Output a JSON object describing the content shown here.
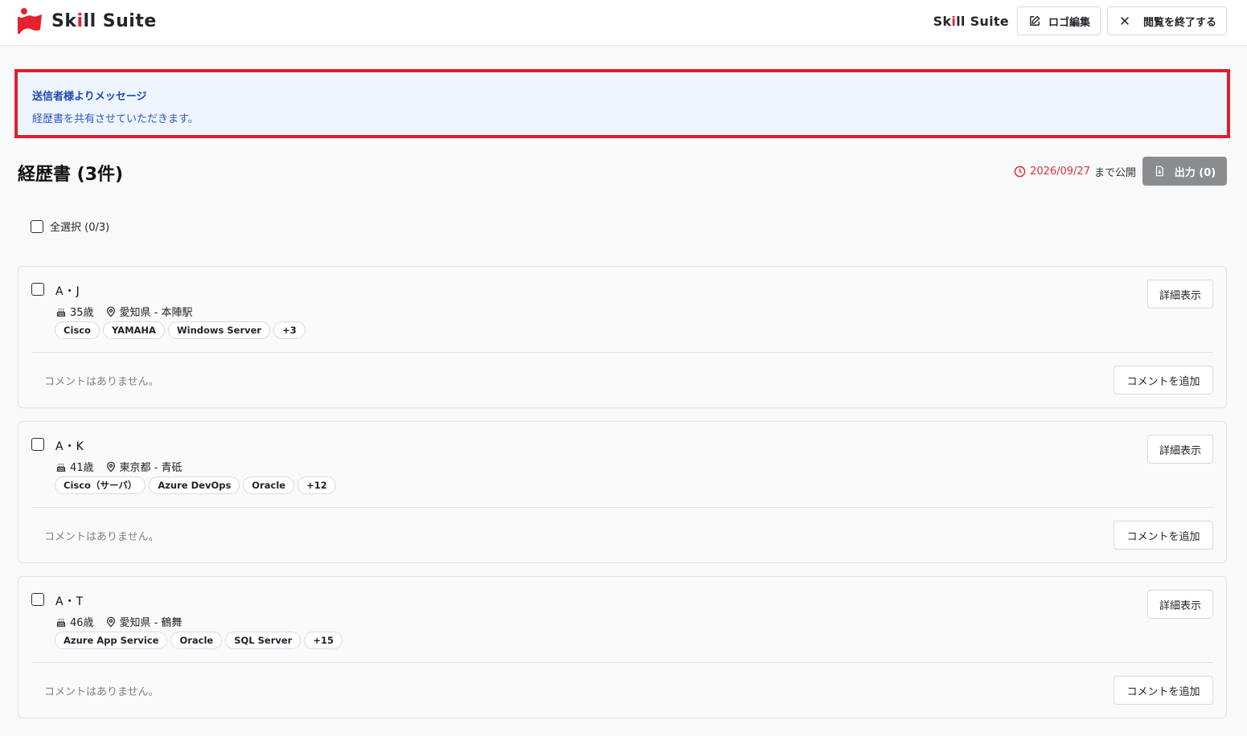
{
  "header": {
    "logo_text_pre": "Sk",
    "logo_text_i": "i",
    "logo_text_post": "ll Suite",
    "brand_pre": "Sk",
    "brand_i": "i",
    "brand_post": "ll Suite",
    "edit_logo_label": "ロゴ編集",
    "end_viewing_label": "閲覧を終了する"
  },
  "message": {
    "title": "送信者様よりメッセージ",
    "body": "経歴書を共有させていただきます。"
  },
  "section": {
    "title": "経歴書 (3件)",
    "expiry_date": "2026/09/27",
    "expiry_suffix": "まで公開",
    "export_label": "出力 (0)"
  },
  "select_all": {
    "label": "全選択 (0/3)"
  },
  "cards": [
    {
      "name": "A・J",
      "age": "35歳",
      "location": "愛知県 - 本陣駅",
      "tags": [
        "Cisco",
        "YAMAHA",
        "Windows Server",
        "+3"
      ],
      "detail_label": "詳細表示",
      "comment_empty": "コメントはありません。",
      "comment_button": "コメントを追加"
    },
    {
      "name": "A・K",
      "age": "41歳",
      "location": "東京都 - 青砥",
      "tags": [
        "Cisco（サーバ）",
        "Azure DevOps",
        "Oracle",
        "+12"
      ],
      "detail_label": "詳細表示",
      "comment_empty": "コメントはありません。",
      "comment_button": "コメントを追加"
    },
    {
      "name": "A・T",
      "age": "46歳",
      "location": "愛知県 - 鶴舞",
      "tags": [
        "Azure App Service",
        "Oracle",
        "SQL Server",
        "+15"
      ],
      "detail_label": "詳細表示",
      "comment_empty": "コメントはありません。",
      "comment_button": "コメントを追加"
    }
  ],
  "colors": {
    "brand_red": "#e8212f",
    "message_bg": "#eef5ff",
    "message_border": "#e01e2a",
    "message_text": "#2f56c2",
    "expiry_red": "#e0303a",
    "export_bg": "#8a8d90"
  },
  "icons": {
    "logo": "skill-suite-flag-logo-icon",
    "edit": "pencil-square-icon",
    "close": "close-icon",
    "clock": "clock-icon",
    "export": "file-download-icon",
    "age": "cake-icon",
    "location": "map-pin-icon"
  }
}
